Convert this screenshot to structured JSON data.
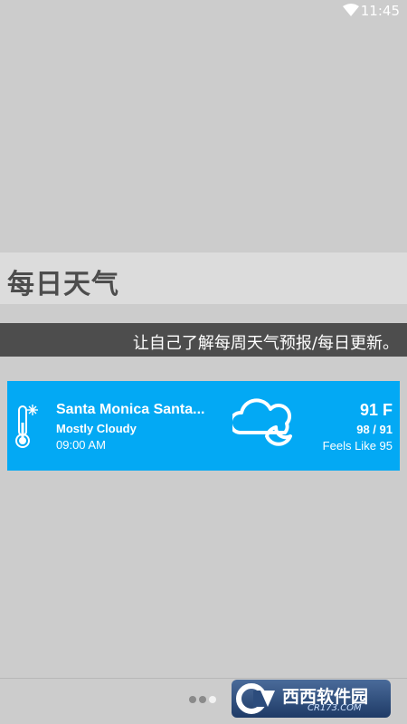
{
  "status_bar": {
    "time": "11:45",
    "wifi_icon": "wifi-icon"
  },
  "header": {
    "title": "每日天气",
    "subtitle": "让自己了解每周天气预报/每日更新。"
  },
  "weather_card": {
    "location": "Santa Monica Santa...",
    "condition": "Mostly Cloudy",
    "time": "09:00 AM",
    "temperature": "91 F",
    "high_low": "98 / 91",
    "feels_like": "Feels Like 95",
    "card_color": "#03a9f4",
    "thermometer_icon": "thermometer-snowflake-icon",
    "weather_icon": "cloud-moon-icon"
  },
  "pager": {
    "total": 3,
    "active_index": 2
  },
  "watermark": {
    "text": "西西软件园",
    "subtext": "CR173.COM"
  }
}
